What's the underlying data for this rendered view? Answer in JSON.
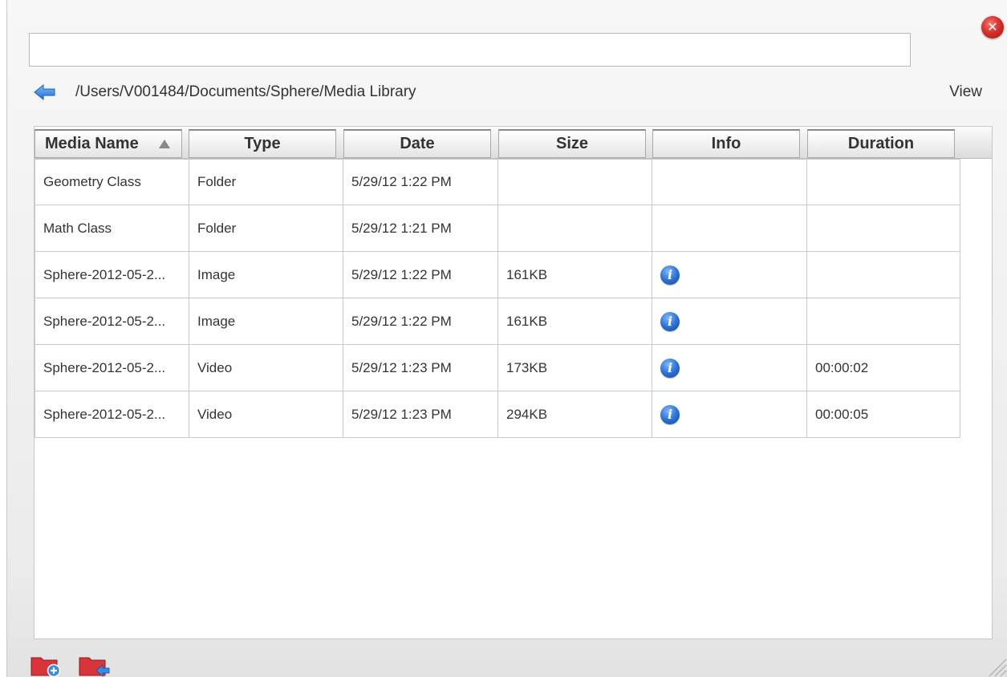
{
  "search": {
    "value": "",
    "placeholder": ""
  },
  "nav": {
    "path": "/Users/V001484/Documents/Sphere/Media Library",
    "view_label": "View"
  },
  "table": {
    "columns": [
      "Media Name",
      "Type",
      "Date",
      "Size",
      "Info",
      "Duration"
    ],
    "sort": {
      "column": "Media Name",
      "direction": "ascending"
    },
    "rows": [
      {
        "name": "Geometry Class",
        "type": "Folder",
        "date": "5/29/12 1:22 PM",
        "size": "",
        "info": false,
        "duration": ""
      },
      {
        "name": "Math Class",
        "type": "Folder",
        "date": "5/29/12 1:21 PM",
        "size": "",
        "info": false,
        "duration": ""
      },
      {
        "name": "Sphere-2012-05-2...",
        "type": "Image",
        "date": "5/29/12 1:22 PM",
        "size": "161KB",
        "info": true,
        "duration": ""
      },
      {
        "name": "Sphere-2012-05-2...",
        "type": "Image",
        "date": "5/29/12 1:22 PM",
        "size": "161KB",
        "info": true,
        "duration": ""
      },
      {
        "name": "Sphere-2012-05-2...",
        "type": "Video",
        "date": "5/29/12 1:23 PM",
        "size": "173KB",
        "info": true,
        "duration": "00:00:02"
      },
      {
        "name": "Sphere-2012-05-2...",
        "type": "Video",
        "date": "5/29/12 1:23 PM",
        "size": "294KB",
        "info": true,
        "duration": "00:00:05"
      }
    ]
  },
  "icons": {
    "close": "close-icon",
    "back": "back-arrow-icon",
    "info": "info-icon",
    "new_folder": "new-folder-icon",
    "move_folder": "move-folder-icon"
  },
  "colors": {
    "accent_blue": "#2d73d6",
    "close_red": "#d7312a",
    "folder_red": "#d8343a"
  }
}
